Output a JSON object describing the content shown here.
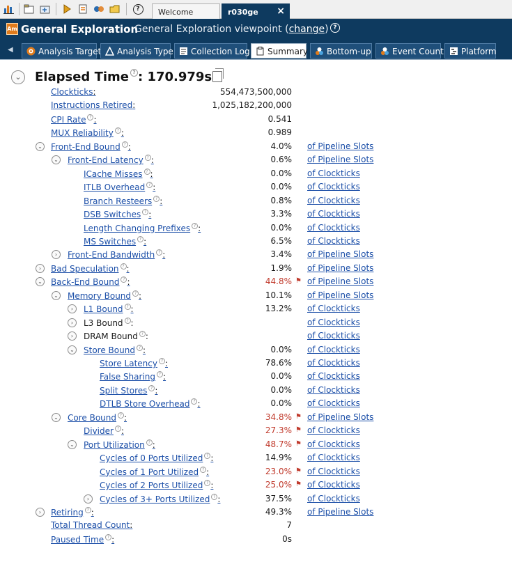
{
  "toolbar": {
    "icons": [
      "chart-icon",
      "open-project-icon",
      "new-project-icon",
      "run-icon",
      "configure-icon",
      "compare-icon",
      "open-result-icon",
      "help-icon"
    ],
    "help_glyph": "?"
  },
  "doc_tabs": [
    {
      "label": "Welcome",
      "active": false
    },
    {
      "label": "r030ge",
      "active": true,
      "close": "×"
    }
  ],
  "viewpoint": {
    "app_icon_text": "Am",
    "title": "General Exploration",
    "subtitle_prefix": "General Exploration viewpoint (",
    "change_link": "change",
    "subtitle_suffix": ")",
    "help_glyph": "?"
  },
  "viewpoint_tabs": [
    {
      "label": "Analysis Target",
      "icon": "target-icon",
      "active": false
    },
    {
      "label": "Analysis Type",
      "icon": "analysis-type-icon",
      "active": false
    },
    {
      "label": "Collection Log",
      "icon": "log-icon",
      "active": false
    },
    {
      "label": "Summary",
      "icon": "summary-icon",
      "active": true
    },
    {
      "label": "Bottom-up",
      "icon": "bottom-up-icon",
      "active": false
    },
    {
      "label": "Event Count",
      "icon": "event-count-icon",
      "active": false
    },
    {
      "label": "Platform",
      "icon": "platform-icon",
      "active": false
    }
  ],
  "summary": {
    "title": "Elapsed Time",
    "value": ": 170.979s",
    "rows": [
      {
        "label": "Clockticks",
        "value": "554,473,500,000",
        "indent": 0,
        "link": true,
        "help": false
      },
      {
        "label": "Instructions Retired",
        "value": "1,025,182,200,000",
        "indent": 0,
        "link": true,
        "help": false
      },
      {
        "label": "CPI Rate",
        "value": "0.541",
        "indent": 0,
        "link": true,
        "help": true
      },
      {
        "label": "MUX Reliability",
        "value": "0.989",
        "indent": 0,
        "link": true,
        "help": true
      },
      {
        "label": "Front-End Bound",
        "value": "4.0%",
        "unit": "of Pipeline Slots",
        "indent": 0,
        "toggle": "collapse",
        "link": true,
        "help": true
      },
      {
        "label": "Front-End Latency",
        "value": "0.6%",
        "unit": "of Pipeline Slots",
        "indent": 1,
        "toggle": "collapse",
        "link": true,
        "help": true
      },
      {
        "label": "ICache Misses",
        "value": "0.0%",
        "unit": "of Clockticks",
        "indent": 2,
        "link": true,
        "help": true,
        "dim": true
      },
      {
        "label": "ITLB Overhead",
        "value": "0.0%",
        "unit": "of Clockticks",
        "indent": 2,
        "link": true,
        "help": true,
        "dim": true
      },
      {
        "label": "Branch Resteers",
        "value": "0.8%",
        "unit": "of Clockticks",
        "indent": 2,
        "link": true,
        "help": true
      },
      {
        "label": "DSB Switches",
        "value": "3.3%",
        "unit": "of Clockticks",
        "indent": 2,
        "link": true,
        "help": true
      },
      {
        "label": "Length Changing Prefixes",
        "value": "0.0%",
        "unit": "of Clockticks",
        "indent": 2,
        "link": true,
        "help": true,
        "dim": true
      },
      {
        "label": "MS Switches",
        "value": "6.5%",
        "unit": "of Clockticks",
        "indent": 2,
        "link": true,
        "help": true
      },
      {
        "label": "Front-End Bandwidth",
        "value": "3.4%",
        "unit": "of Pipeline Slots",
        "indent": 1,
        "toggle": "expand",
        "link": true,
        "help": true
      },
      {
        "label": "Bad Speculation",
        "value": "1.9%",
        "unit": "of Pipeline Slots",
        "indent": 0,
        "toggle": "expand",
        "link": true,
        "help": true
      },
      {
        "label": "Back-End Bound",
        "value": "44.8%",
        "unit": "of Pipeline Slots",
        "indent": 0,
        "toggle": "collapse",
        "link": true,
        "help": true,
        "hot": true
      },
      {
        "label": "Memory Bound",
        "value": "10.1%",
        "unit": "of Pipeline Slots",
        "indent": 1,
        "toggle": "collapse",
        "link": true,
        "help": true
      },
      {
        "label": "L1 Bound",
        "value": "13.2%",
        "unit": "of Clockticks",
        "indent": 2,
        "toggle": "expand",
        "link": true,
        "help": true
      },
      {
        "label": "L3 Bound",
        "value": "",
        "unit": "of Clockticks",
        "indent": 2,
        "toggle": "expand",
        "link": false,
        "help": true
      },
      {
        "label": "DRAM Bound",
        "value": "",
        "unit": "of Clockticks",
        "indent": 2,
        "toggle": "expand",
        "link": false,
        "help": true
      },
      {
        "label": "Store Bound",
        "value": "0.0%",
        "unit": "of Clockticks",
        "indent": 2,
        "toggle": "collapse",
        "link": true,
        "help": true,
        "dim": true
      },
      {
        "label": "Store Latency",
        "value": "78.6%",
        "unit": "of Clockticks",
        "indent": 3,
        "link": true,
        "help": true
      },
      {
        "label": "False Sharing",
        "value": "0.0%",
        "unit": "of Clockticks",
        "indent": 3,
        "link": true,
        "help": true,
        "dim": true
      },
      {
        "label": "Split Stores",
        "value": "0.0%",
        "unit": "of Clockticks",
        "indent": 3,
        "link": true,
        "help": true,
        "dim": true
      },
      {
        "label": "DTLB Store Overhead",
        "value": "0.0%",
        "unit": "of Clockticks",
        "indent": 3,
        "link": true,
        "help": true,
        "dim": true
      },
      {
        "label": "Core Bound",
        "value": "34.8%",
        "unit": "of Pipeline Slots",
        "indent": 1,
        "toggle": "collapse",
        "link": true,
        "help": true,
        "hot": true
      },
      {
        "label": "Divider",
        "value": "27.3%",
        "unit": "of Clockticks",
        "indent": 2,
        "link": true,
        "help": true,
        "hot": true
      },
      {
        "label": "Port Utilization",
        "value": "48.7%",
        "unit": "of Clockticks",
        "indent": 2,
        "toggle": "collapse",
        "link": true,
        "help": true,
        "hot": true
      },
      {
        "label": "Cycles of 0 Ports Utilized",
        "value": "14.9%",
        "unit": "of Clockticks",
        "indent": 3,
        "link": true,
        "help": true
      },
      {
        "label": "Cycles of 1 Port Utilized",
        "value": "23.0%",
        "unit": "of Clockticks",
        "indent": 3,
        "link": true,
        "help": true,
        "hot": true
      },
      {
        "label": "Cycles of 2 Ports Utilized",
        "value": "25.0%",
        "unit": "of Clockticks",
        "indent": 3,
        "link": true,
        "help": true,
        "hot": true
      },
      {
        "label": "Cycles of 3+ Ports Utilized",
        "value": "37.5%",
        "unit": "of Clockticks",
        "indent": 3,
        "toggle": "expand",
        "link": true,
        "help": true
      },
      {
        "label": "Retiring",
        "value": "49.3%",
        "unit": "of Pipeline Slots",
        "indent": 0,
        "toggle": "expand",
        "link": true,
        "help": true
      },
      {
        "label": "Total Thread Count",
        "value": "7",
        "indent": 0,
        "link": true,
        "help": false
      },
      {
        "label": "Paused Time",
        "value": "0s",
        "indent": 0,
        "link": true,
        "help": true
      }
    ]
  },
  "glyphs": {
    "collapse": "⌄",
    "expand": "›",
    "flag": "⚑",
    "help": "?"
  },
  "colors": {
    "header_bg": "#0e3a5f",
    "link": "#1c4fa8",
    "hot": "#c0392b"
  }
}
